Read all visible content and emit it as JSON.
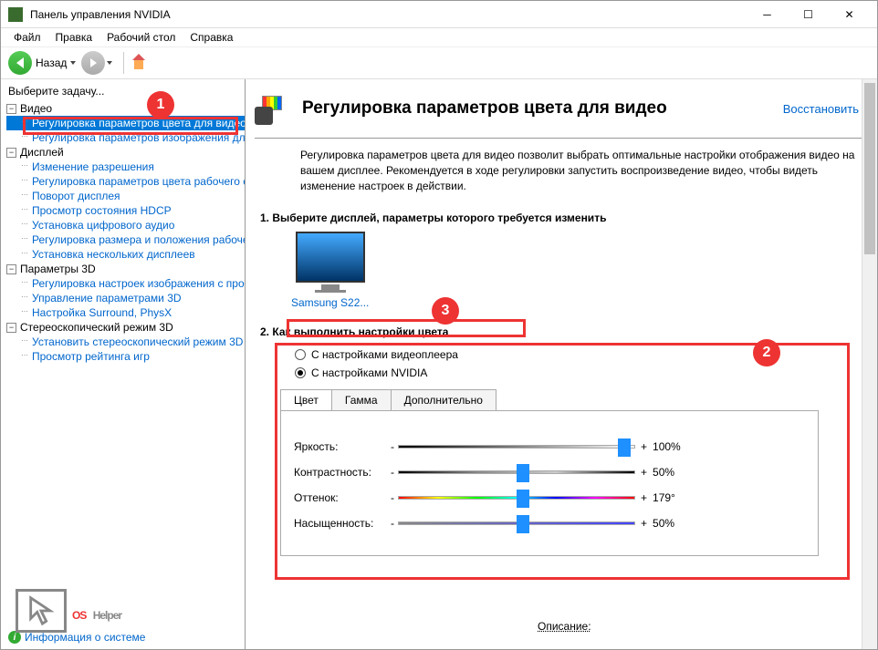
{
  "window": {
    "title": "Панель управления NVIDIA"
  },
  "menu": {
    "file": "Файл",
    "edit": "Правка",
    "desktop": "Рабочий стол",
    "help": "Справка"
  },
  "toolbar": {
    "back": "Назад"
  },
  "sidebar": {
    "prompt": "Выберите задачу...",
    "video": {
      "label": "Видео",
      "items": [
        "Регулировка параметров цвета для видео",
        "Регулировка параметров изображения для видео"
      ]
    },
    "display": {
      "label": "Дисплей",
      "items": [
        "Изменение разрешения",
        "Регулировка параметров цвета рабочего стола",
        "Поворот дисплея",
        "Просмотр состояния HDCP",
        "Установка цифрового аудио",
        "Регулировка размера и положения рабочего стола",
        "Установка нескольких дисплеев"
      ]
    },
    "params3d": {
      "label": "Параметры 3D",
      "items": [
        "Регулировка настроек изображения с просмотром",
        "Управление параметрами 3D",
        "Настройка Surround, PhysX"
      ]
    },
    "stereo": {
      "label": "Стереоскопический режим 3D",
      "items": [
        "Установить стереоскопический режим 3D",
        "Просмотр рейтинга игр"
      ]
    },
    "sysinfo": "Информация о системе"
  },
  "main": {
    "title": "Регулировка параметров цвета для видео",
    "restore": "Восстановить",
    "description": "Регулировка параметров цвета для видео позволит выбрать оптимальные настройки отображения видео на вашем дисплее. Рекомендуется в ходе регулировки запустить воспроизведение видео, чтобы видеть изменение настроек в действии.",
    "section1": "1. Выберите дисплей, параметры которого требуется изменить",
    "display_name": "Samsung S22...",
    "section2": "2. Как выполнить настройки цвета",
    "radio1": "С настройками видеоплеера",
    "radio2": "С настройками NVIDIA",
    "tabs": {
      "color": "Цвет",
      "gamma": "Гамма",
      "extra": "Дополнительно"
    },
    "sliders": {
      "brightness": {
        "label": "Яркость:",
        "value": "100%",
        "pos": 93
      },
      "contrast": {
        "label": "Контрастность:",
        "value": "50%",
        "pos": 50
      },
      "hue": {
        "label": "Оттенок:",
        "value": "179°",
        "pos": 50
      },
      "saturation": {
        "label": "Насыщенность:",
        "value": "50%",
        "pos": 50
      }
    },
    "bottom_label": "Описание:"
  },
  "watermark": {
    "os": "OS",
    "helper": "Helper"
  },
  "badges": {
    "b1": "1",
    "b2": "2",
    "b3": "3"
  }
}
